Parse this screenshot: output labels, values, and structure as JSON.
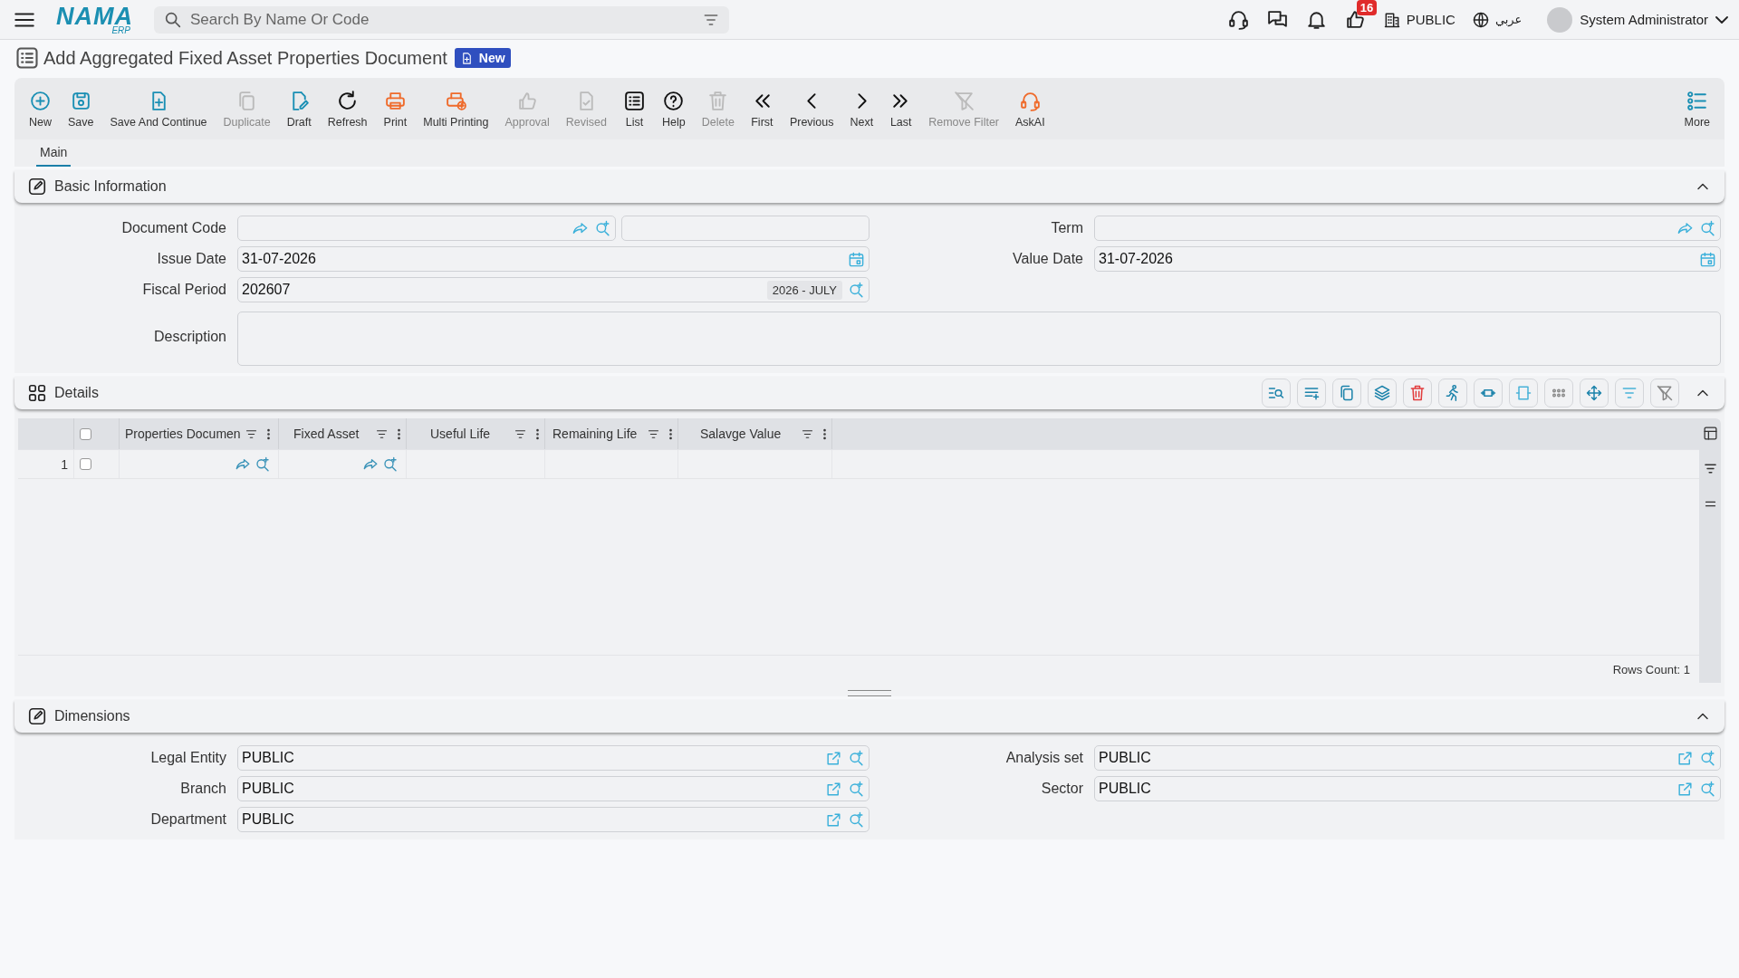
{
  "topbar": {
    "logo": "NAMA",
    "logo_sub": "ERP",
    "search": {
      "placeholder": "Search By Name Or Code"
    },
    "notifications_badge": "16",
    "company": "PUBLIC",
    "language": "عربي",
    "user": "System Administrator"
  },
  "page": {
    "title": "Add Aggregated Fixed Asset Properties Document",
    "status": "New"
  },
  "toolbar": [
    {
      "label": "New",
      "disabled": false
    },
    {
      "label": "Save",
      "disabled": false
    },
    {
      "label": "Save And Continue",
      "disabled": false
    },
    {
      "label": "Duplicate",
      "disabled": true
    },
    {
      "label": "Draft",
      "disabled": false
    },
    {
      "label": "Refresh",
      "disabled": false
    },
    {
      "label": "Print",
      "disabled": false
    },
    {
      "label": "Multi Printing",
      "disabled": false
    },
    {
      "label": "Approval",
      "disabled": true
    },
    {
      "label": "Revised",
      "disabled": true
    },
    {
      "label": "List",
      "disabled": false
    },
    {
      "label": "Help",
      "disabled": false
    },
    {
      "label": "Delete",
      "disabled": true
    },
    {
      "label": "First",
      "disabled": false
    },
    {
      "label": "Previous",
      "disabled": false
    },
    {
      "label": "Next",
      "disabled": false
    },
    {
      "label": "Last",
      "disabled": false
    },
    {
      "label": "Remove Filter",
      "disabled": true
    },
    {
      "label": "AskAI",
      "disabled": false
    }
  ],
  "more": "More",
  "tabs": [
    {
      "label": "Main",
      "selected": true
    }
  ],
  "basic_information": {
    "title": "Basic Information",
    "expanded": true,
    "fields": [
      {
        "label": "Document Code",
        "kind": "code"
      },
      {
        "label": "Term",
        "kind": "lookup"
      },
      {
        "label": "Issue Date",
        "kind": "date",
        "value": "31-07-2026"
      },
      {
        "label": "Value Date",
        "kind": "date",
        "value": "31-07-2026"
      },
      {
        "label": "Fiscal Period",
        "kind": "period",
        "value": "202607",
        "tag": "2026 - JULY"
      },
      {
        "label": "Description",
        "kind": "textarea"
      }
    ]
  },
  "details": {
    "title": "Details",
    "expanded": true,
    "all_checked": false,
    "columns": [
      "Properties Documen",
      "Fixed Asset",
      "Useful Life",
      "Remaining Life",
      "Salavge Value"
    ],
    "rows": [
      {
        "number": "1",
        "checked": false
      }
    ],
    "rows_count": "Rows Count: 1"
  },
  "dimensions": {
    "title": "Dimensions",
    "expanded": true,
    "fields": [
      {
        "label": "Legal Entity",
        "kind": "link",
        "value": "PUBLIC"
      },
      {
        "label": "Analysis set",
        "kind": "link",
        "value": "PUBLIC"
      },
      {
        "label": "Branch",
        "kind": "link",
        "value": "PUBLIC"
      },
      {
        "label": "Sector",
        "kind": "link",
        "value": "PUBLIC"
      },
      {
        "label": "Department",
        "kind": "link",
        "value": "PUBLIC"
      }
    ]
  }
}
